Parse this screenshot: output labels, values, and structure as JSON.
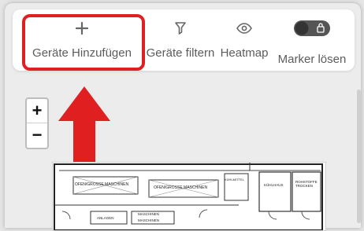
{
  "toolbar": {
    "add_devices": {
      "label": "Geräte Hinzufügen",
      "icon": "plus-icon"
    },
    "filter_devices": {
      "label": "Geräte filtern",
      "icon": "filter-icon"
    },
    "heatmap": {
      "label": "Heatmap",
      "icon": "eye-icon"
    },
    "release_marker": {
      "label": "Marker lösen",
      "icon": "lock-toggle-icon"
    }
  },
  "zoom": {
    "in": "+",
    "out": "−"
  },
  "floorplan": {
    "labels": [
      "OFEN/GROSSE MASCHINEN",
      "OFEN/GROSSE MASCHINEN",
      "KÜHLMITTEL",
      "KÜHLHAUS",
      "ROHSTOFFE TROCKEN",
      "ANLAGEN",
      "MASCHINEN",
      "MASCHINEN"
    ]
  },
  "colors": {
    "highlight": "#e02020",
    "arrow": "#e02020",
    "toggle": "#555555"
  }
}
